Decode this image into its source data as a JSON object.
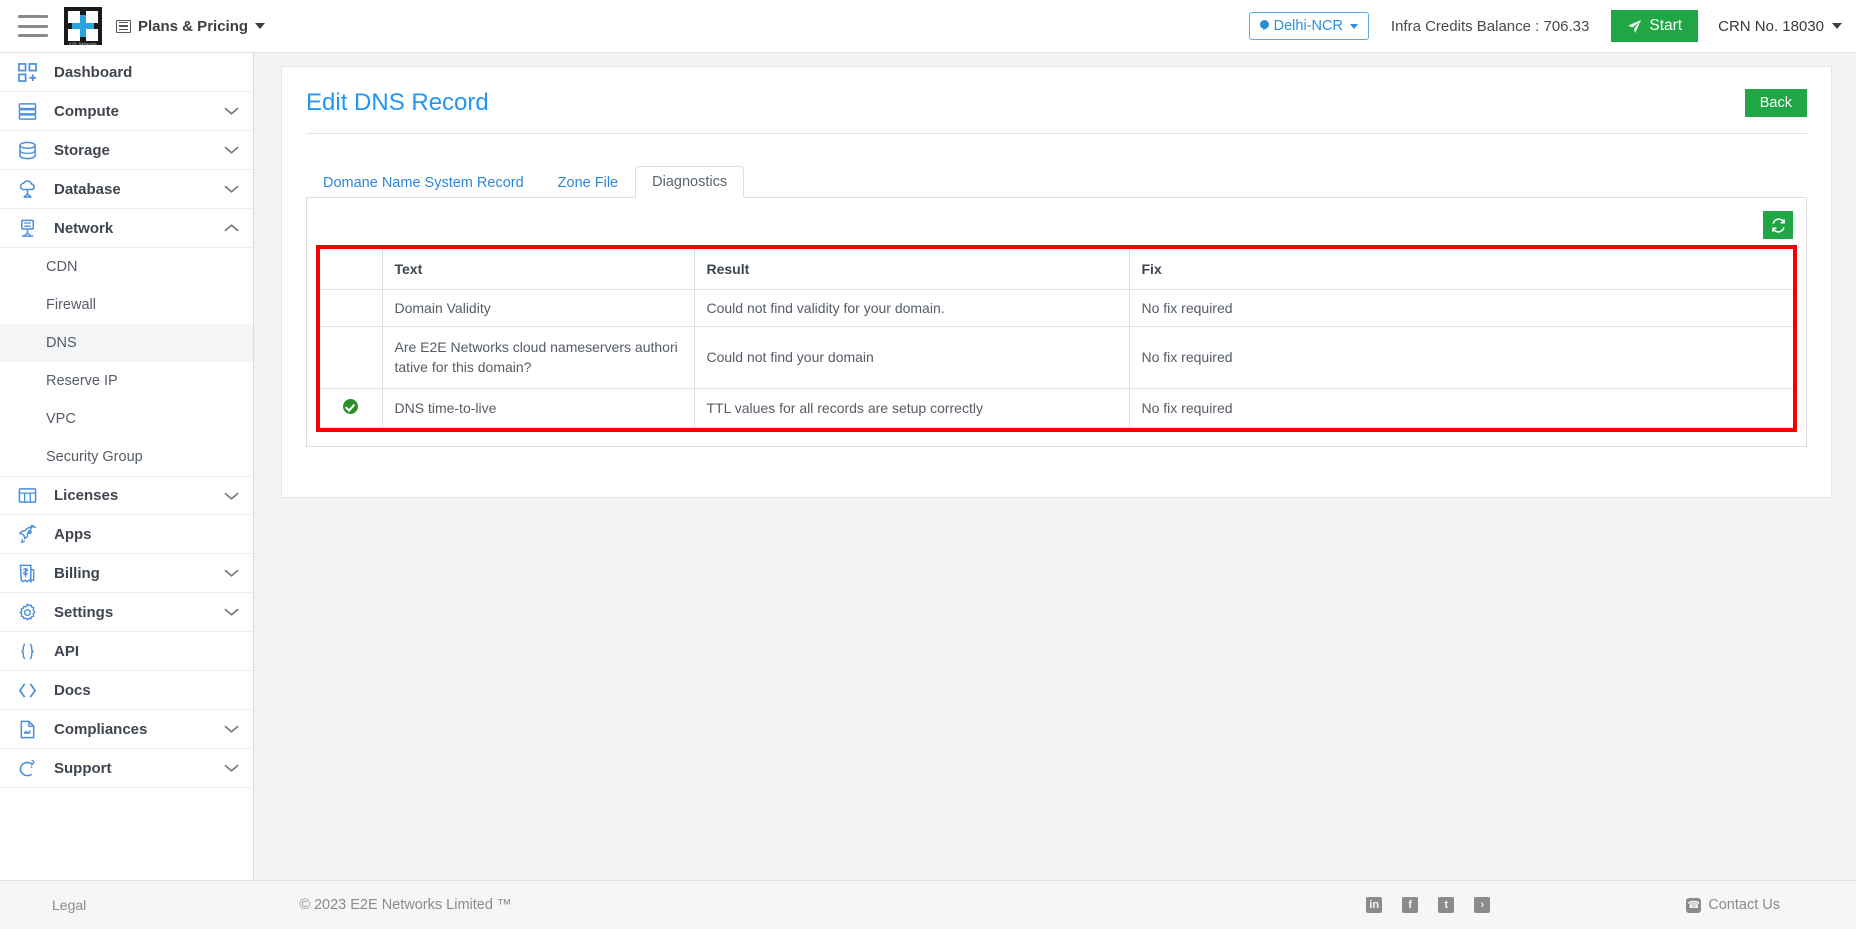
{
  "topbar": {
    "menu_icon": "hamburger-icon",
    "brand": "E2E Networks",
    "plans_label": "Plans & Pricing",
    "region": "Delhi-NCR",
    "credits": "Infra Credits Balance : 706.33",
    "start_label": "Start",
    "crn": "CRN No. 18030"
  },
  "sidebar": {
    "items": [
      {
        "label": "Dashboard",
        "icon": "dashboard-icon",
        "expandable": false
      },
      {
        "label": "Compute",
        "icon": "compute-icon",
        "expandable": true,
        "state": "collapsed"
      },
      {
        "label": "Storage",
        "icon": "storage-icon",
        "expandable": true,
        "state": "collapsed"
      },
      {
        "label": "Database",
        "icon": "database-icon",
        "expandable": true,
        "state": "collapsed"
      },
      {
        "label": "Network",
        "icon": "network-icon",
        "expandable": true,
        "state": "expanded"
      }
    ],
    "network_children": [
      {
        "label": "CDN",
        "active": false
      },
      {
        "label": "Firewall",
        "active": false
      },
      {
        "label": "DNS",
        "active": true
      },
      {
        "label": "Reserve IP",
        "active": false
      },
      {
        "label": "VPC",
        "active": false
      },
      {
        "label": "Security Group",
        "active": false
      }
    ],
    "items_after": [
      {
        "label": "Licenses",
        "icon": "licenses-icon",
        "expandable": true
      },
      {
        "label": "Apps",
        "icon": "apps-rocket-icon",
        "expandable": false
      },
      {
        "label": "Billing",
        "icon": "billing-icon",
        "expandable": true
      },
      {
        "label": "Settings",
        "icon": "gear-icon",
        "expandable": true
      },
      {
        "label": "API",
        "icon": "api-braces-icon",
        "expandable": false
      },
      {
        "label": "Docs",
        "icon": "docs-code-icon",
        "expandable": false
      },
      {
        "label": "Compliances",
        "icon": "compliances-doc-icon",
        "expandable": true
      },
      {
        "label": "Support",
        "icon": "support-chat-icon",
        "expandable": true
      }
    ]
  },
  "page": {
    "title": "Edit DNS Record",
    "back_label": "Back",
    "tabs": [
      {
        "label": "Domane Name System Record",
        "active": false
      },
      {
        "label": "Zone File",
        "active": false
      },
      {
        "label": "Diagnostics",
        "active": true
      }
    ],
    "refresh_icon": "refresh-icon"
  },
  "table": {
    "columns": [
      "",
      "Text",
      "Result",
      "Fix"
    ],
    "rows": [
      {
        "status": "",
        "text": "Domain Validity",
        "result": "Could not find validity for your domain.",
        "fix": "No fix required"
      },
      {
        "status": "",
        "text": "Are E2E Networks cloud nameservers authoritative for this domain?",
        "result": "Could not find your domain",
        "fix": "No fix required"
      },
      {
        "status": "check-success",
        "text": "DNS time-to-live",
        "result": "TTL values for all records are setup correctly",
        "fix": "No fix required"
      }
    ]
  },
  "footer": {
    "legal": "Legal",
    "copyright": "© 2023 E2E Networks Limited ™",
    "social": [
      {
        "name": "linkedin-icon",
        "glyph": "in"
      },
      {
        "name": "facebook-icon",
        "glyph": "f"
      },
      {
        "name": "twitter-icon",
        "glyph": "t"
      },
      {
        "name": "rss-icon",
        "glyph": "›"
      }
    ],
    "contact": "Contact Us"
  },
  "colors": {
    "accent_blue": "#2196f3",
    "green": "#21a645",
    "highlight_red": "#f80000",
    "sidebar_icon_blue": "#4a90d9"
  }
}
